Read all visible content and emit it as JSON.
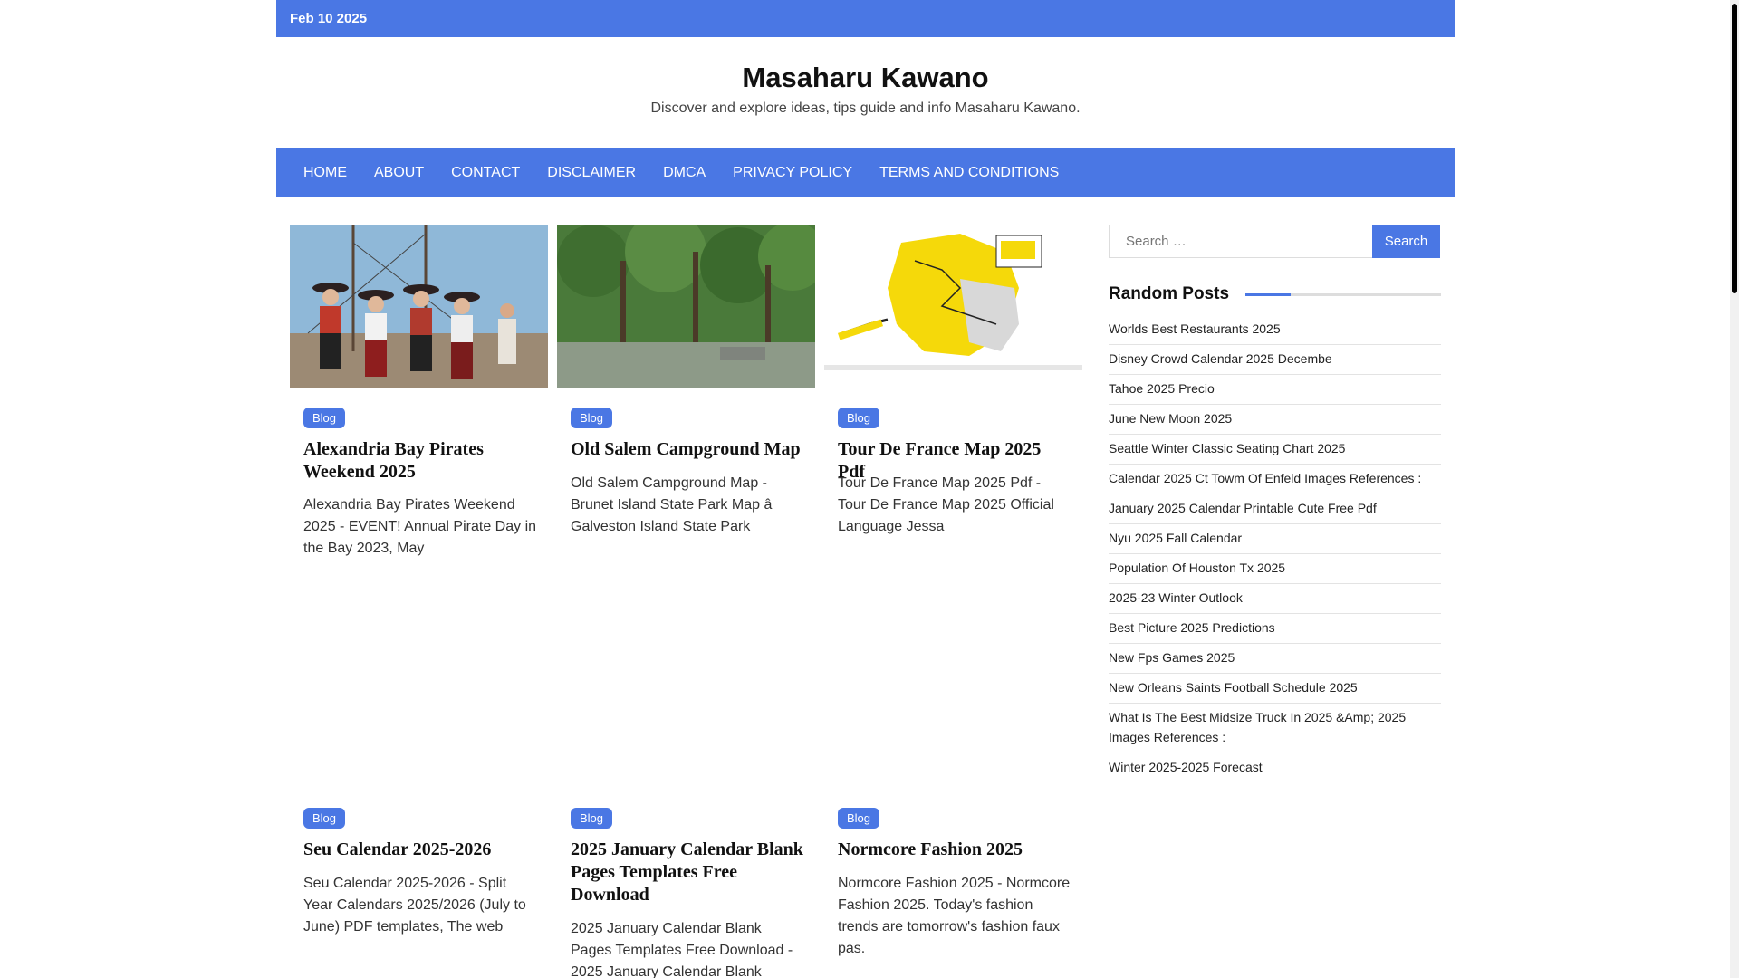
{
  "topbar": {
    "date": "Feb 10 2025"
  },
  "header": {
    "title": "Masaharu Kawano",
    "description": "Discover and explore ideas, tips guide and info Masaharu Kawano."
  },
  "nav": {
    "items": [
      "HOME",
      "ABOUT",
      "CONTACT",
      "DISCLAIMER",
      "DMCA",
      "PRIVACY POLICY",
      "TERMS AND CONDITIONS"
    ]
  },
  "posts": [
    {
      "category": "Blog",
      "title": "Alexandria Bay Pirates Weekend 2025",
      "excerpt": "Alexandria Bay Pirates Weekend 2025 - EVENT! Annual Pirate Day in the Bay 2023, May"
    },
    {
      "category": "Blog",
      "title": "Old Salem Campground Map",
      "excerpt": "Old Salem Campground Map - Brunet Island State Park Map â Galveston Island State Park"
    },
    {
      "category": "Blog",
      "title": "Tour De France Map 2025 Pdf",
      "excerpt": "Tour De France Map 2025 Pdf - Tour De France Map 2025 Official Language Jessa"
    },
    {
      "category": "Blog",
      "title": "Seu Calendar 2025-2026",
      "excerpt": "Seu Calendar 2025-2026 - Split Year Calendars 2025/2026 (July to June) PDF templates, The web"
    },
    {
      "category": "Blog",
      "title": "2025 January Calendar Blank Pages Templates Free Download",
      "excerpt": "2025 January Calendar Blank Pages Templates Free Download - 2025 January Calendar Blank"
    },
    {
      "category": "Blog",
      "title": "Normcore Fashion 2025",
      "excerpt": "Normcore Fashion 2025 - Normcore Fashion 2025. Today's fashion trends are tomorrow's fashion faux pas."
    }
  ],
  "sidebar": {
    "search_placeholder": "Search …",
    "search_button": "Search",
    "random_posts_title": "Random Posts",
    "random_posts": [
      "Worlds Best Restaurants 2025",
      "Disney Crowd Calendar 2025 Decembe",
      "Tahoe 2025 Precio",
      "June New Moon 2025",
      "Seattle Winter Classic Seating Chart 2025",
      "Calendar 2025 Ct Towm Of Enfeld Images References :",
      "January 2025 Calendar Printable Cute Free Pdf",
      "Nyu 2025 Fall Calendar",
      "Population Of Houston Tx 2025",
      "2025-23 Winter Outlook",
      "Best Picture 2025 Predictions",
      "New Fps Games 2025",
      "New Orleans Saints Football Schedule 2025",
      "What Is The Best Midsize Truck In 2025 &Amp; 2025 Images References :",
      "Winter 2025-2025 Forecast"
    ]
  },
  "colors": {
    "accent": "#4a77e4"
  }
}
